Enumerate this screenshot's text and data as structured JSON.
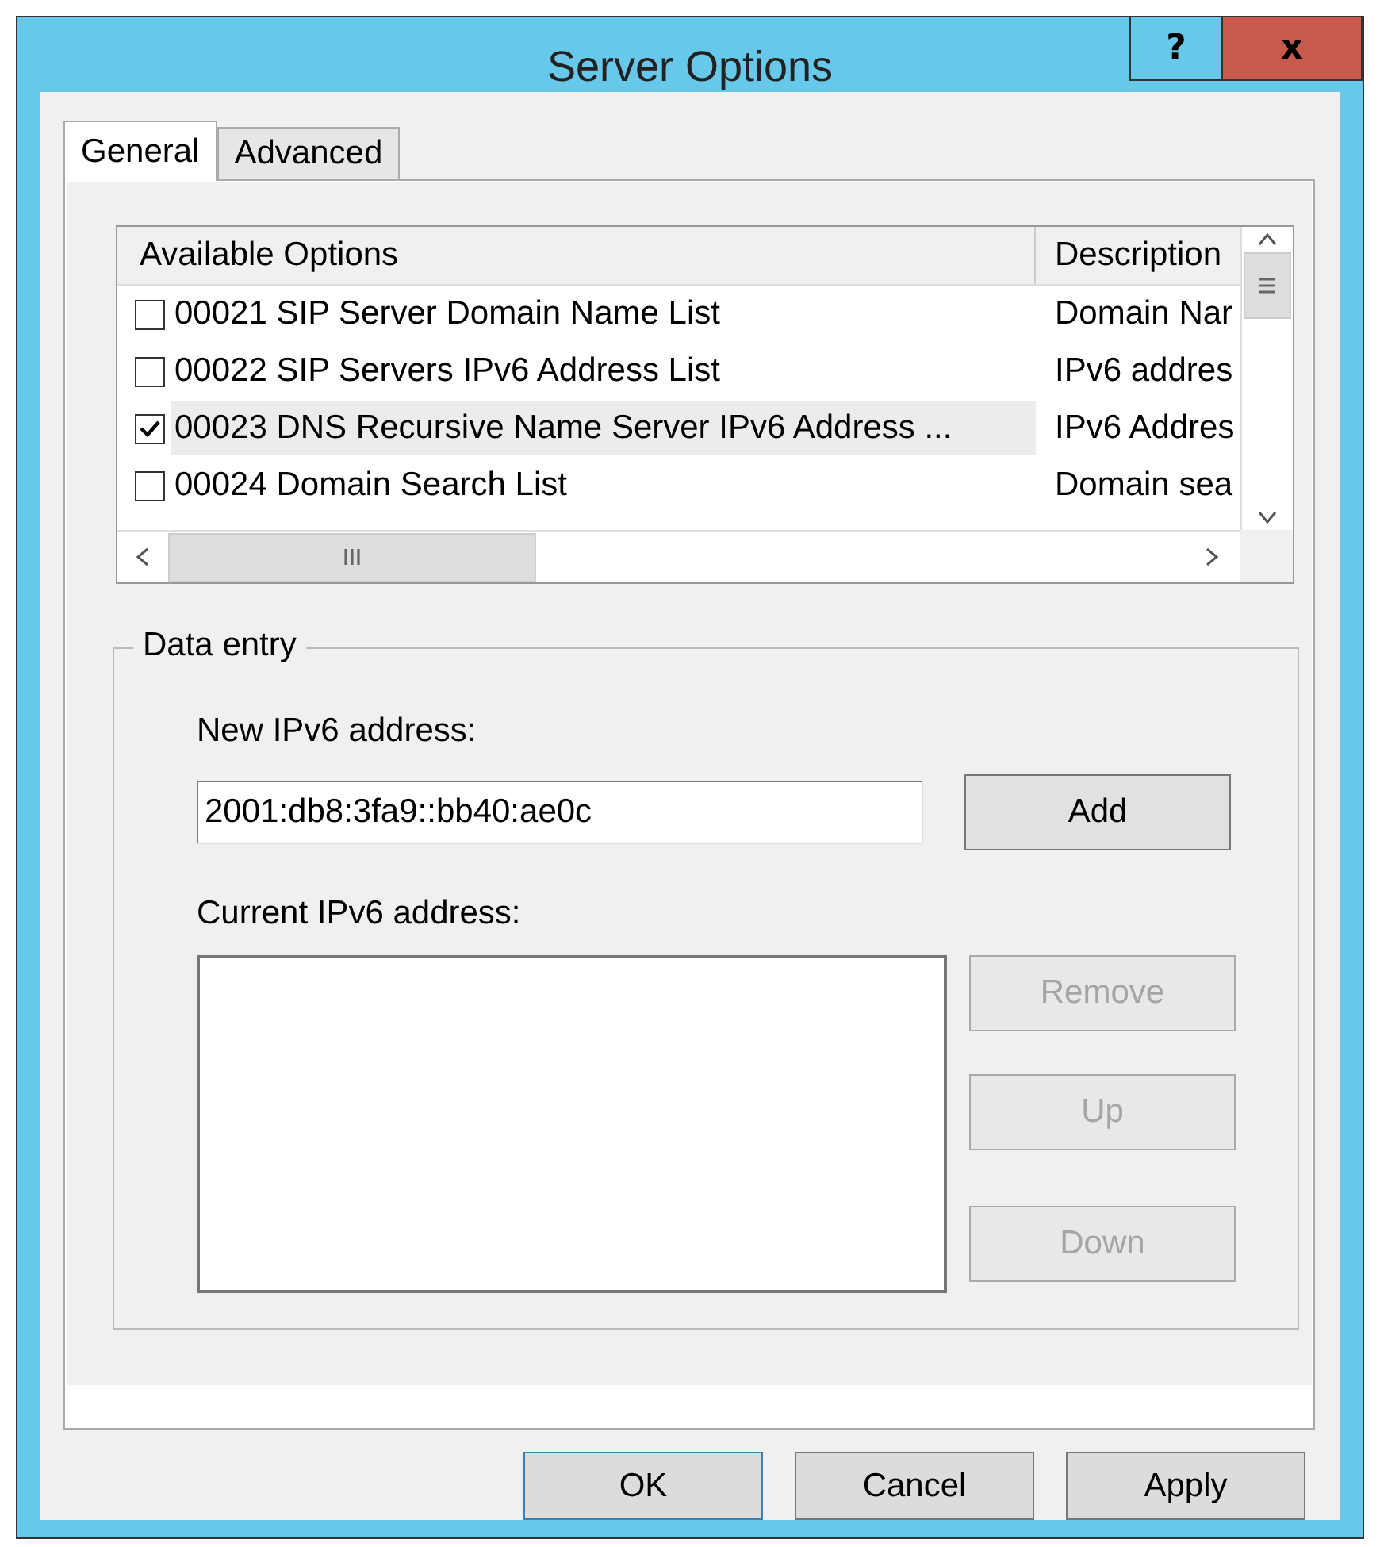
{
  "window": {
    "title": "Server Options",
    "help_button": "?",
    "close_button": "x"
  },
  "tabs": [
    {
      "label": "General",
      "selected": true
    },
    {
      "label": "Advanced",
      "selected": false
    }
  ],
  "options": {
    "columns": [
      "Available Options",
      "Description"
    ],
    "rows": [
      {
        "name": "00021 SIP Server Domain Name List",
        "description": "Domain Nar",
        "checked": false,
        "selected": false
      },
      {
        "name": "00022 SIP Servers IPv6 Address List",
        "description": "IPv6 addres",
        "checked": false,
        "selected": false
      },
      {
        "name": "00023 DNS Recursive Name Server IPv6 Address ...",
        "description": "IPv6 Addres",
        "checked": true,
        "selected": true
      },
      {
        "name": "00024 Domain Search List",
        "description": "Domain sea",
        "checked": false,
        "selected": false
      }
    ]
  },
  "data_entry": {
    "legend": "Data entry",
    "new_label": "New IPv6 address:",
    "new_value": "2001:db8:3fa9::bb40:ae0c",
    "add_button": {
      "label": "Add",
      "disabled": false
    },
    "current_label": "Current IPv6 address:",
    "side_buttons": [
      {
        "label": "Remove",
        "disabled": true
      },
      {
        "label": "Up",
        "disabled": true
      },
      {
        "label": "Down",
        "disabled": true
      }
    ]
  },
  "buttons": [
    {
      "label": "OK",
      "default": true
    },
    {
      "label": "Cancel",
      "default": false
    },
    {
      "label": "Apply",
      "default": false
    }
  ]
}
